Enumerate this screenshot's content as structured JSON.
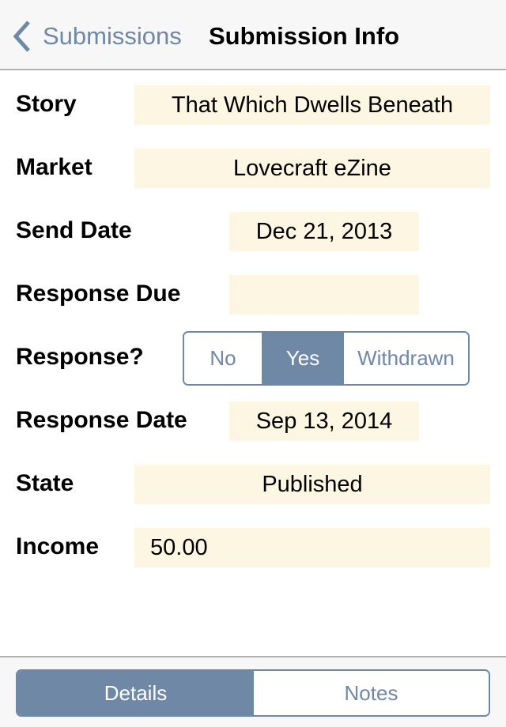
{
  "nav": {
    "back_label": "Submissions",
    "title": "Submission Info"
  },
  "colors": {
    "accent": "#6e88a6",
    "field_bg": "#fdf6e2"
  },
  "form": {
    "story": {
      "label": "Story",
      "value": "That Which Dwells Beneath"
    },
    "market": {
      "label": "Market",
      "value": "Lovecraft eZine"
    },
    "send_date": {
      "label": "Send Date",
      "value": "Dec 21, 2013"
    },
    "response_due": {
      "label": "Response Due",
      "value": ""
    },
    "response": {
      "label": "Response?",
      "options": [
        "No",
        "Yes",
        "Withdrawn"
      ],
      "selected": "Yes"
    },
    "response_date": {
      "label": "Response Date",
      "value": "Sep 13, 2014"
    },
    "state": {
      "label": "State",
      "value": "Published"
    },
    "income": {
      "label": "Income",
      "value": "50.00"
    }
  },
  "bottom_tabs": {
    "options": [
      "Details",
      "Notes"
    ],
    "selected": "Details"
  }
}
